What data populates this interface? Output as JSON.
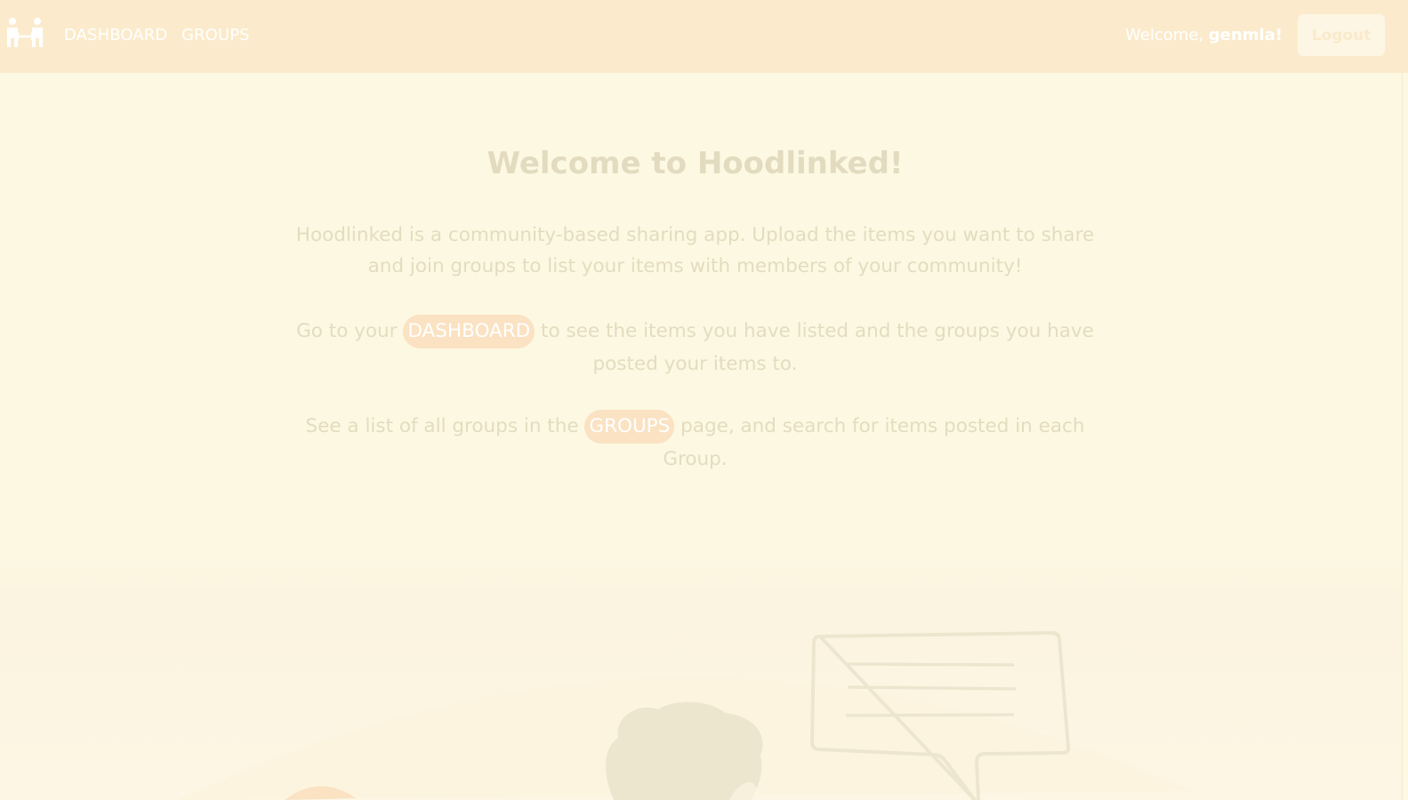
{
  "nav": {
    "logo_icon": "people-exchange-icon",
    "links": [
      "DASHBOARD",
      "GROUPS"
    ],
    "welcome_prefix": "Welcome,",
    "username": "genmla!",
    "logout_label": "Logout"
  },
  "main": {
    "title": "Welcome to Hoodlinked!",
    "intro": "Hoodlinked is a community-based sharing app. Upload the items you want to share and join groups to list your items with members of your community!",
    "dashboard_before": "Go to your",
    "dashboard_link": "DASHBOARD",
    "dashboard_after": "to see the items you have listed and the groups you have posted your items to.",
    "groups_before": "See a list of all groups in the",
    "groups_link": "GROUPS",
    "groups_after": "page, and search for items posted in each Group."
  },
  "colors": {
    "nav_bg": "#fbebcc",
    "page_bg": "#fdf8e2",
    "pill_bg": "#fae2c2",
    "text": "#e3dcc0"
  }
}
